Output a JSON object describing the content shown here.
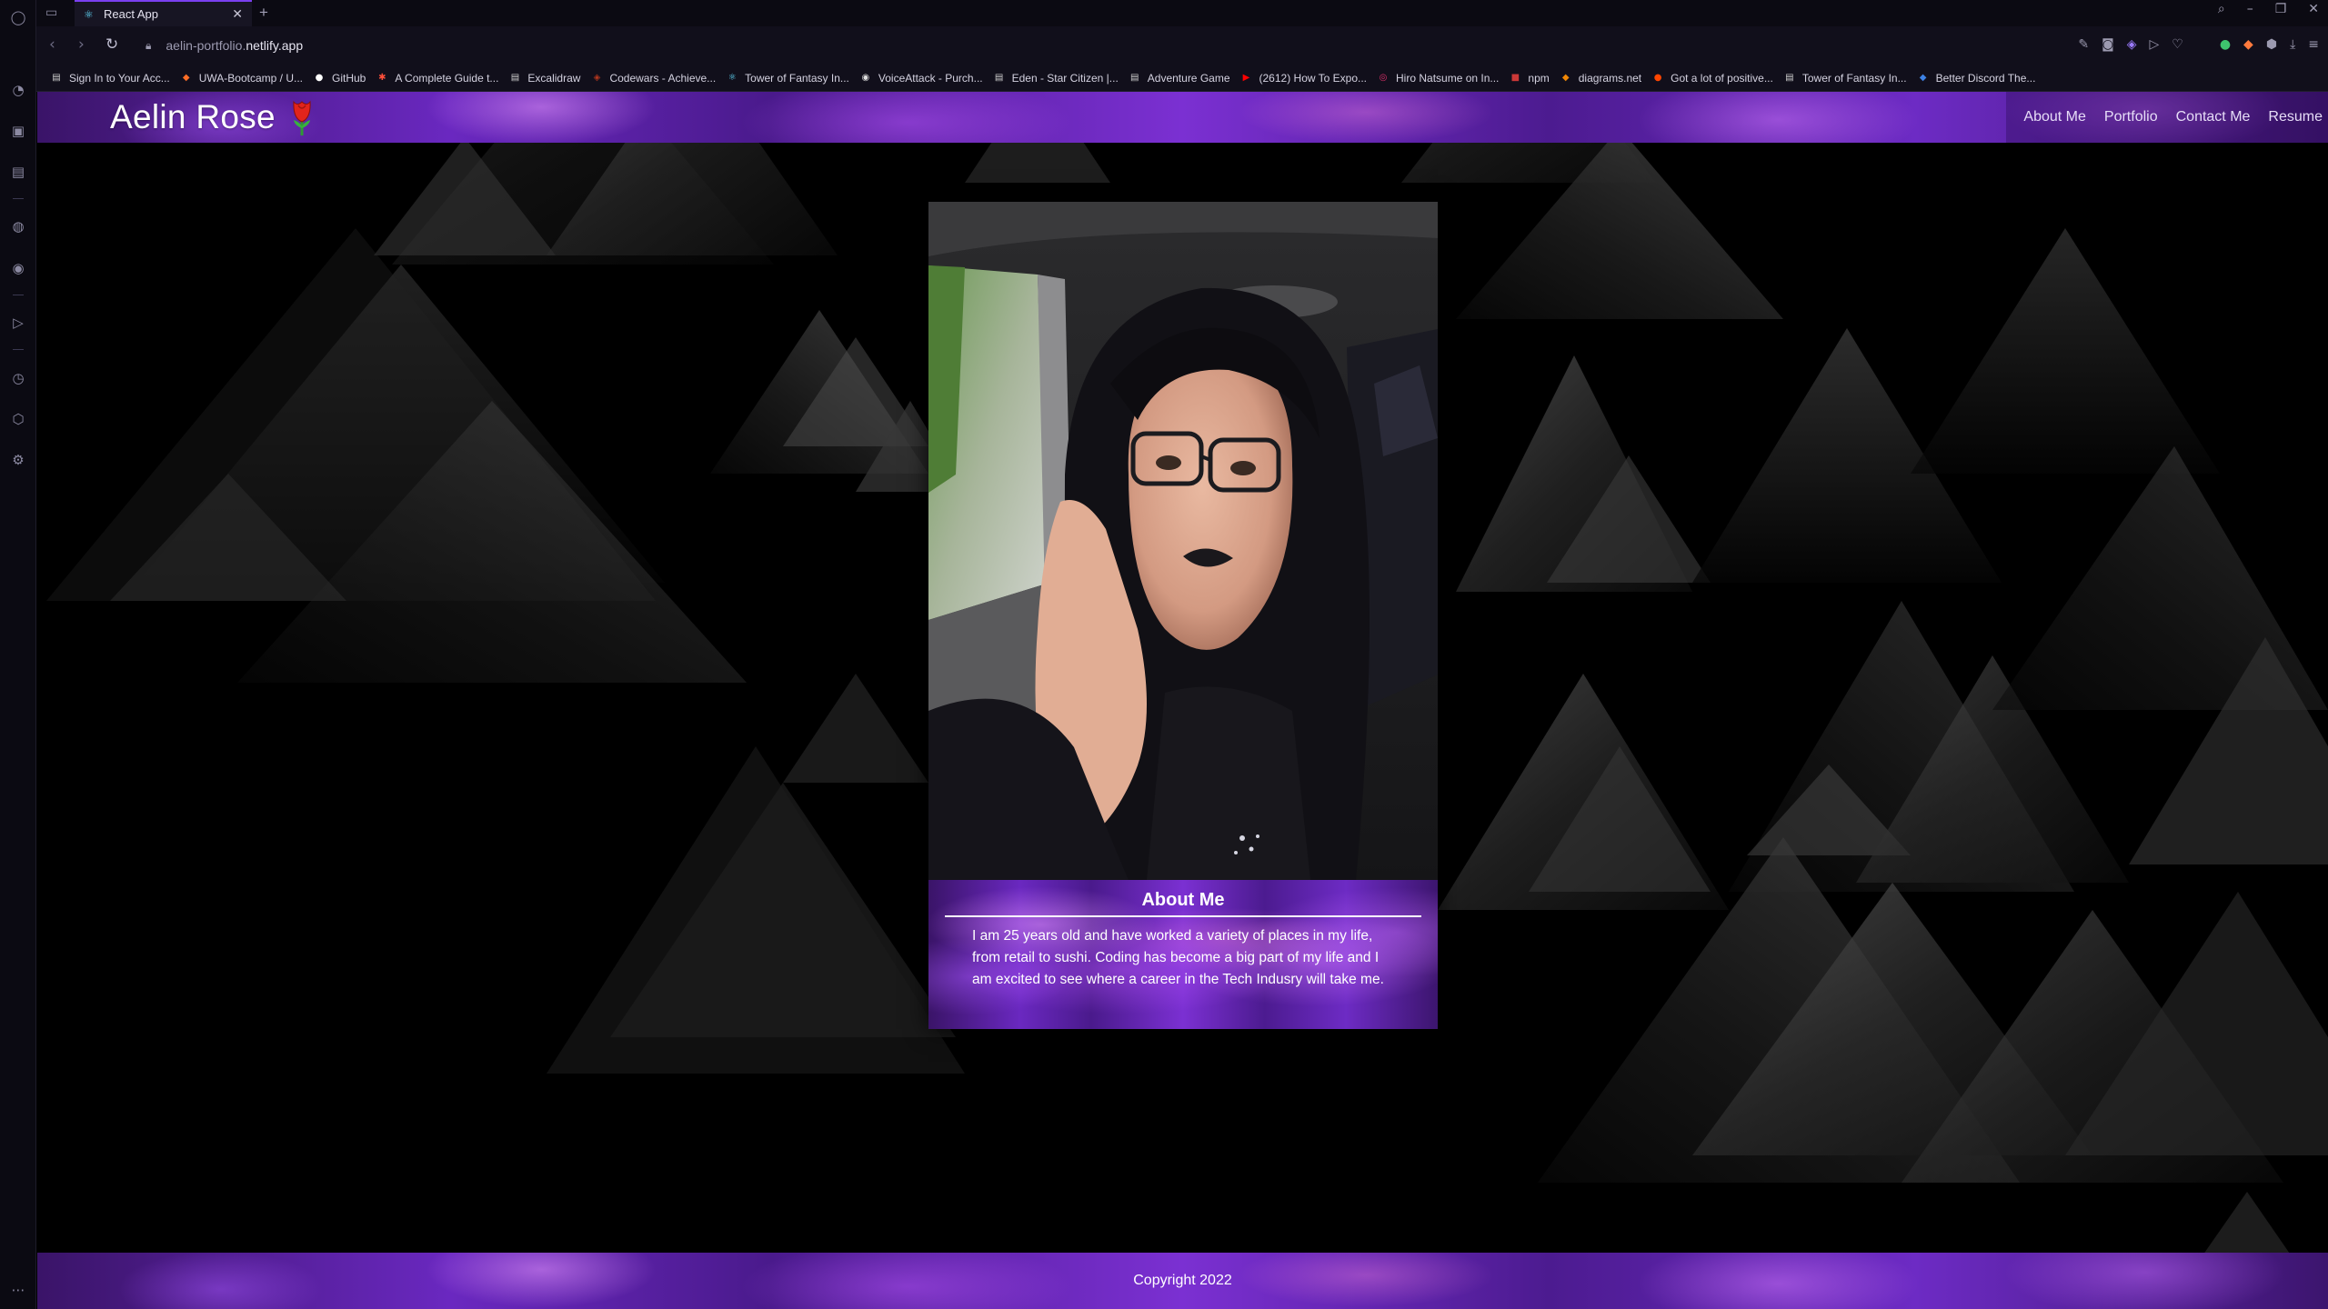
{
  "browser": {
    "tab": {
      "title": "React App"
    },
    "url": {
      "scheme_host": "aelin-portfolio.",
      "domain": "netlify.app"
    },
    "bookmarks": [
      {
        "label": "Sign In to Your Acc...",
        "icon": "page-icon",
        "color": "#cfcfcf"
      },
      {
        "label": "UWA-Bootcamp / U...",
        "icon": "gitlab-icon",
        "color": "#fc6d26"
      },
      {
        "label": "GitHub",
        "icon": "github-icon",
        "color": "#ffffff"
      },
      {
        "label": "A Complete Guide t...",
        "icon": "asterisk-icon",
        "color": "#ff4f3a"
      },
      {
        "label": "Excalidraw",
        "icon": "page-icon",
        "color": "#cfcfcf"
      },
      {
        "label": "Codewars - Achieve...",
        "icon": "codewars-icon",
        "color": "#b1361e"
      },
      {
        "label": "Tower of Fantasy In...",
        "icon": "react-icon",
        "color": "#61dafb"
      },
      {
        "label": "VoiceAttack - Purch...",
        "icon": "voiceattack-icon",
        "color": "#dddddd"
      },
      {
        "label": "Eden - Star Citizen |...",
        "icon": "page-icon",
        "color": "#cfcfcf"
      },
      {
        "label": "Adventure Game",
        "icon": "page-icon",
        "color": "#cfcfcf"
      },
      {
        "label": "(2612) How To Expo...",
        "icon": "youtube-icon",
        "color": "#ff0000"
      },
      {
        "label": "Hiro Natsume on In...",
        "icon": "instagram-icon",
        "color": "#e1306c"
      },
      {
        "label": "npm",
        "icon": "npm-icon",
        "color": "#cb3837"
      },
      {
        "label": "diagrams.net",
        "icon": "diagrams-icon",
        "color": "#f08705"
      },
      {
        "label": "Got a lot of positive...",
        "icon": "reddit-icon",
        "color": "#ff4500"
      },
      {
        "label": "Tower of Fantasy In...",
        "icon": "page-icon",
        "color": "#cfcfcf"
      },
      {
        "label": "Better Discord The...",
        "icon": "betterdiscord-icon",
        "color": "#3e82e5"
      }
    ]
  },
  "site": {
    "brand": "Aelin Rose",
    "nav": [
      "About Me",
      "Portfolio",
      "Contact Me",
      "Resume"
    ],
    "about": {
      "title": "About Me",
      "text": "I am 25 years old and have worked a variety of places in my life, from retail to sushi. Coding has become a big part of my life and I am excited to see where a career in the Tech Indusry will take me."
    },
    "footer": "Copyright 2022"
  },
  "colors": {
    "accent": "#7a3ff0",
    "nebula_purple": "#6a28c0",
    "background": "#000000"
  }
}
